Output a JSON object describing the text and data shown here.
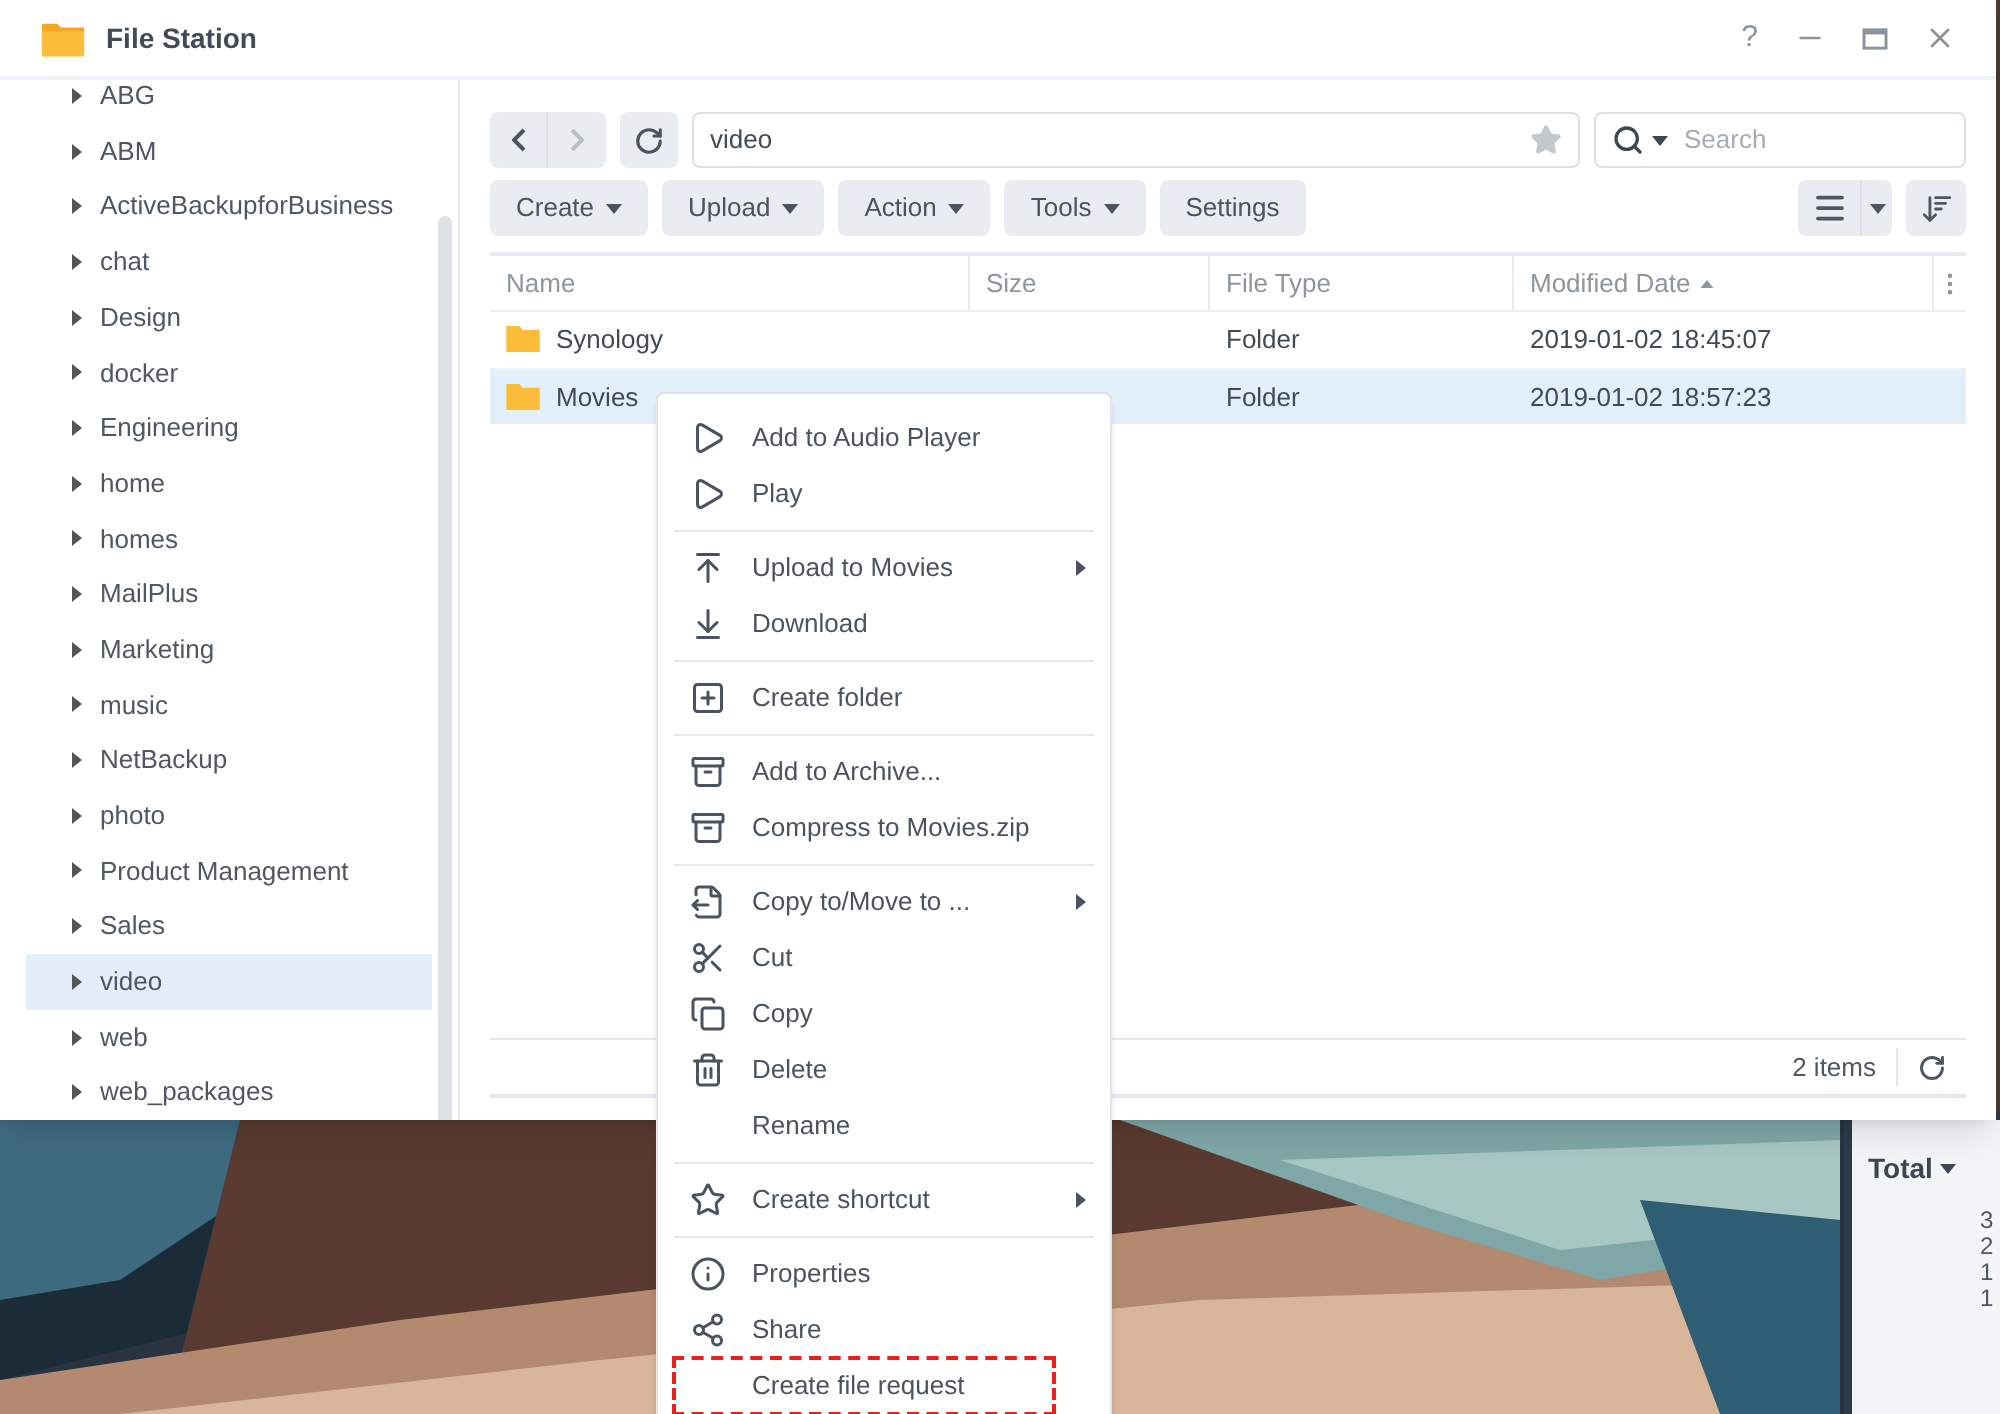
{
  "window": {
    "title": "File Station",
    "help": "?"
  },
  "sidebar": {
    "items": [
      {
        "label": "ABG",
        "selected": false,
        "expanded": false
      },
      {
        "label": "ABM",
        "selected": false,
        "expanded": false
      },
      {
        "label": "ActiveBackupforBusiness",
        "selected": false,
        "expanded": false
      },
      {
        "label": "chat",
        "selected": false,
        "expanded": false
      },
      {
        "label": "Design",
        "selected": false,
        "expanded": false
      },
      {
        "label": "docker",
        "selected": false,
        "expanded": false
      },
      {
        "label": "Engineering",
        "selected": false,
        "expanded": false
      },
      {
        "label": "home",
        "selected": false,
        "expanded": false
      },
      {
        "label": "homes",
        "selected": false,
        "expanded": false
      },
      {
        "label": "MailPlus",
        "selected": false,
        "expanded": false
      },
      {
        "label": "Marketing",
        "selected": false,
        "expanded": false
      },
      {
        "label": "music",
        "selected": false,
        "expanded": false
      },
      {
        "label": "NetBackup",
        "selected": false,
        "expanded": false
      },
      {
        "label": "photo",
        "selected": false,
        "expanded": false
      },
      {
        "label": "Product Management",
        "selected": false,
        "expanded": false
      },
      {
        "label": "Sales",
        "selected": false,
        "expanded": false
      },
      {
        "label": "video",
        "selected": true,
        "expanded": false
      },
      {
        "label": "web",
        "selected": false,
        "expanded": false
      },
      {
        "label": "web_packages",
        "selected": false,
        "expanded": false
      }
    ]
  },
  "navigation": {
    "back": {
      "disabled": false
    },
    "forward": {
      "disabled": true
    }
  },
  "path": {
    "value": "video"
  },
  "search": {
    "placeholder": "Search"
  },
  "toolbar": {
    "buttons": [
      {
        "label": "Create",
        "dropdown": true
      },
      {
        "label": "Upload",
        "dropdown": true
      },
      {
        "label": "Action",
        "dropdown": true
      },
      {
        "label": "Tools",
        "dropdown": true
      },
      {
        "label": "Settings",
        "dropdown": false
      }
    ]
  },
  "table": {
    "columns": [
      {
        "label": "Name",
        "sorted": false
      },
      {
        "label": "Size",
        "sorted": false
      },
      {
        "label": "File Type",
        "sorted": false
      },
      {
        "label": "Modified Date",
        "sorted": true
      }
    ],
    "rows": [
      {
        "name": "Synology",
        "type": "Folder",
        "modified": "2019-01-02 18:45:07",
        "selected": false
      },
      {
        "name": "Movies",
        "type": "Folder",
        "modified": "2019-01-02 18:57:23",
        "selected": true
      }
    ]
  },
  "status_bar": {
    "count": "2 items"
  },
  "context_menu": {
    "groups": [
      [
        {
          "label": "Add to Audio Player",
          "submenu": false,
          "highlighted": false
        },
        {
          "label": "Play",
          "submenu": false,
          "highlighted": false
        }
      ],
      [
        {
          "label": "Upload to Movies",
          "submenu": true,
          "highlighted": false
        },
        {
          "label": "Download",
          "submenu": false,
          "highlighted": false
        }
      ],
      [
        {
          "label": "Create folder",
          "submenu": false,
          "highlighted": false
        }
      ],
      [
        {
          "label": "Add to Archive...",
          "submenu": false,
          "highlighted": false
        },
        {
          "label": "Compress to Movies.zip",
          "submenu": false,
          "highlighted": false
        }
      ],
      [
        {
          "label": "Copy to/Move to ...",
          "submenu": true,
          "highlighted": false
        },
        {
          "label": "Cut",
          "submenu": false,
          "highlighted": false
        },
        {
          "label": "Copy",
          "submenu": false,
          "highlighted": false
        },
        {
          "label": "Delete",
          "submenu": false,
          "highlighted": false
        },
        {
          "label": "Rename",
          "submenu": false,
          "highlighted": false
        }
      ],
      [
        {
          "label": "Create shortcut",
          "submenu": true,
          "highlighted": false
        }
      ],
      [
        {
          "label": "Properties",
          "submenu": false,
          "highlighted": false
        },
        {
          "label": "Share",
          "submenu": false,
          "highlighted": false
        },
        {
          "label": "Create file request",
          "submenu": false,
          "highlighted": true
        }
      ]
    ]
  },
  "desktop_widget": {
    "heading": "Total",
    "values": [
      "3",
      "2",
      "1",
      "1"
    ]
  }
}
